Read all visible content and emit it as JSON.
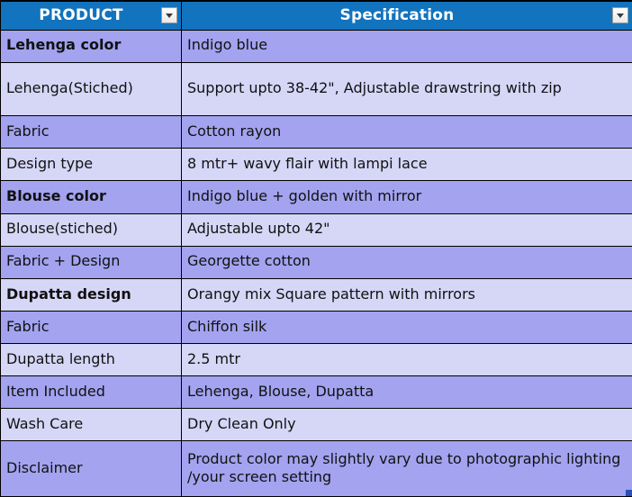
{
  "colors": {
    "header_background": "#1273be",
    "header_text": "#ffffff",
    "row_dark": "#a3a3f0",
    "row_light": "#d6d6f7",
    "border": "#000000",
    "selection_handle": "#2b4fb8"
  },
  "table": {
    "columns": [
      {
        "key": "product",
        "label": "PRODUCT",
        "filter_icon": "chevron-down-icon"
      },
      {
        "key": "specification",
        "label": "Specification",
        "filter_icon": "chevron-down-icon"
      }
    ],
    "rows": [
      {
        "product": "Lehenga color",
        "specification": "Indigo blue",
        "product_bold": true,
        "shade": "dark",
        "height": "std"
      },
      {
        "product": "Lehenga(Stiched)",
        "specification": "Support upto 38-42\", Adjustable drawstring with zip",
        "product_bold": false,
        "shade": "light",
        "height": "tall"
      },
      {
        "product": "Fabric",
        "specification": "Cotton rayon",
        "product_bold": false,
        "shade": "dark",
        "height": "std"
      },
      {
        "product": "Design type",
        "specification": "8 mtr+ wavy flair with lampi lace",
        "product_bold": false,
        "shade": "light",
        "height": "std"
      },
      {
        "product": "Blouse color",
        "specification": "Indigo blue + golden with mirror",
        "product_bold": true,
        "shade": "dark",
        "height": "std"
      },
      {
        "product": "Blouse(stiched)",
        "specification": "Adjustable upto 42\"",
        "product_bold": false,
        "shade": "light",
        "height": "std"
      },
      {
        "product": "Fabric + Design",
        "specification": "Georgette cotton",
        "product_bold": false,
        "shade": "dark",
        "height": "std"
      },
      {
        "product": "Dupatta design",
        "specification": "Orangy mix Square pattern with mirrors",
        "product_bold": true,
        "shade": "light",
        "height": "std"
      },
      {
        "product": "Fabric",
        "specification": "Chiffon silk",
        "product_bold": false,
        "shade": "dark",
        "height": "std"
      },
      {
        "product": "Dupatta length",
        "specification": "2.5 mtr",
        "product_bold": false,
        "shade": "light",
        "height": "std"
      },
      {
        "product": "Item Included",
        "specification": "Lehenga, Blouse, Dupatta",
        "product_bold": false,
        "shade": "dark",
        "height": "std"
      },
      {
        "product": "Wash Care",
        "specification": "Dry Clean Only",
        "product_bold": false,
        "shade": "light",
        "height": "std"
      },
      {
        "product": "Disclaimer",
        "specification": "Product color may slightly vary due to photographic lighting /your screen setting",
        "product_bold": false,
        "shade": "dark",
        "height": "last"
      }
    ]
  }
}
